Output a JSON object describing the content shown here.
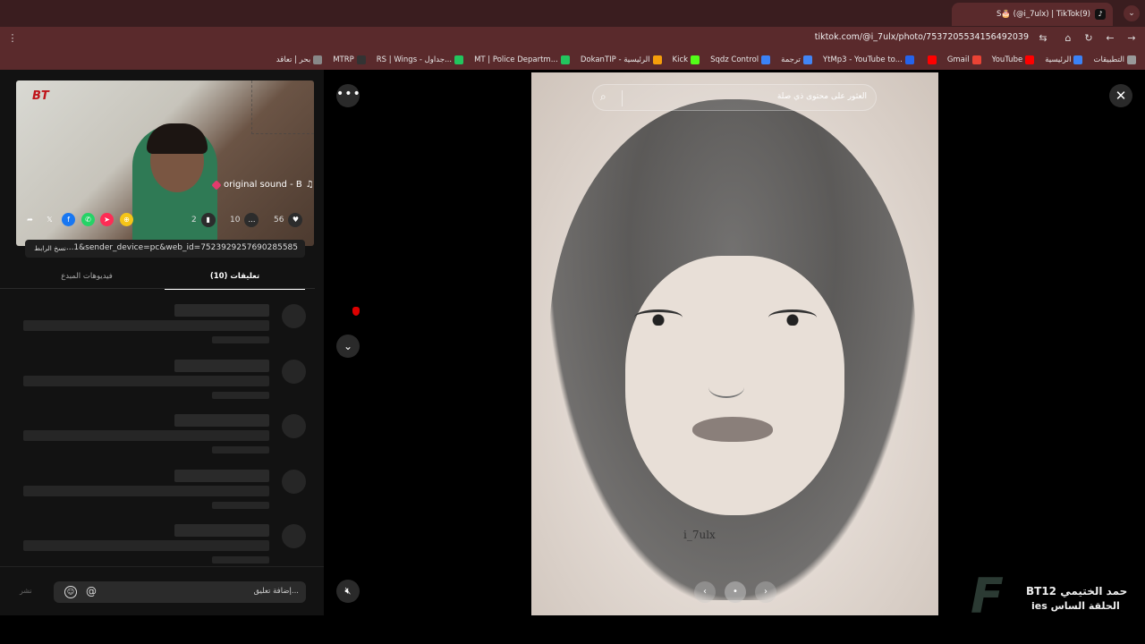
{
  "browser": {
    "tab_title": "S🎂 (@i_7ulx) | TikTok(9)",
    "url": "tiktok.com/@i_7ulx/photo/7537205534156492039",
    "bookmarks": [
      {
        "label": "التطبيقات",
        "color": "#999999"
      },
      {
        "label": "الرئيسية",
        "color": "#3b82f6"
      },
      {
        "label": "YouTube",
        "color": "#ff0000"
      },
      {
        "label": "Gmail",
        "color": "#ea4335"
      },
      {
        "label": "",
        "color": "#ff0000"
      },
      {
        "label": "YtMp3 - YouTube to...",
        "color": "#2563eb"
      },
      {
        "label": "ترجمة",
        "color": "#4285f4"
      },
      {
        "label": "Sqdz Control",
        "color": "#3b82f6"
      },
      {
        "label": "Kick",
        "color": "#53fc18"
      },
      {
        "label": "DokanTIP - الرئيسية",
        "color": "#f59e0b"
      },
      {
        "label": "MT | Police Departm...",
        "color": "#22c55e"
      },
      {
        "label": "RS | Wings - جداول...",
        "color": "#22c55e"
      },
      {
        "label": "MTRP",
        "color": "#333333"
      },
      {
        "label": "بحر | تعاقد",
        "color": "#888888"
      }
    ]
  },
  "stream": {
    "logo": "BT"
  },
  "post": {
    "sound": "original sound - B",
    "likes": "56",
    "comments": "10",
    "saves": "2",
    "share_link": "...1&sender_device=pc&web_id=7523929257690285585",
    "copy_link_label": "نسخ الرابط",
    "tab_comments": "(10) تعليقات",
    "tab_creator_videos": "فيديوهات المبدع",
    "comment_placeholder": "إضافة تعليق...",
    "post_label": "نشر"
  },
  "photo": {
    "search_placeholder": "العثور على محتوى ذي صلة",
    "signature": "i_7ulx",
    "page_dot": "•"
  },
  "watermark": {
    "line1": "BT12 حمد الختيمي",
    "line2": "ies الحلقة الساس"
  },
  "colors": {
    "tab_strip": "#3a1d1f",
    "toolbar": "#5a2a2c",
    "panel": "#121212",
    "skeleton": "#2a2a2a"
  }
}
